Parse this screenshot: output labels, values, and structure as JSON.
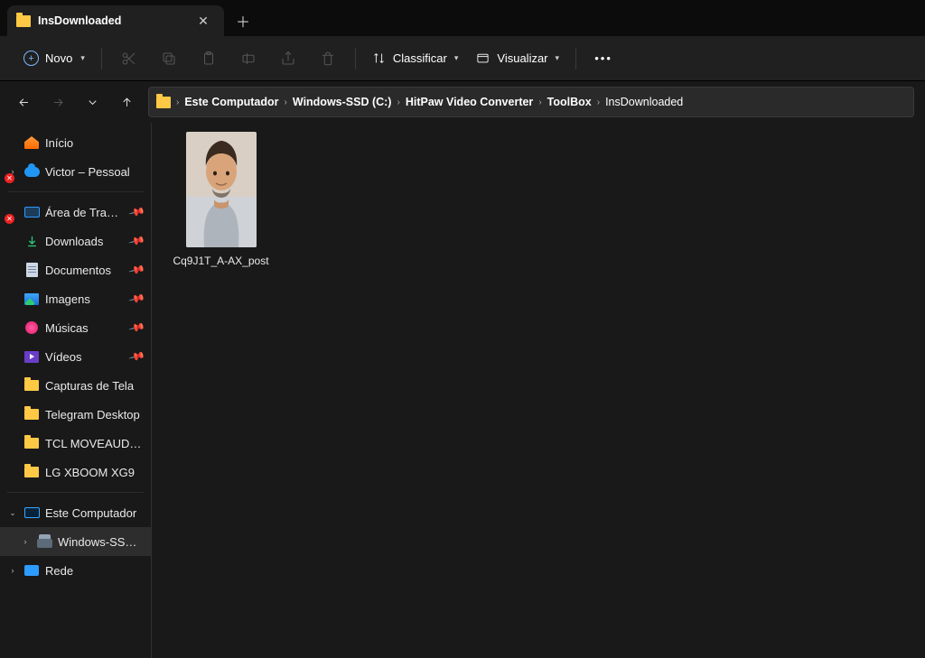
{
  "tab": {
    "title": "InsDownloaded"
  },
  "toolbar": {
    "novo": "Novo",
    "classificar": "Classificar",
    "visualizar": "Visualizar"
  },
  "breadcrumb": [
    "Este Computador",
    "Windows-SSD (C:)",
    "HitPaw Video Converter",
    "ToolBox",
    "InsDownloaded"
  ],
  "sidebar": {
    "home": "Início",
    "onedrive": "Victor – Pessoal",
    "quick": {
      "desktop": "Área de Trabalho",
      "downloads": "Downloads",
      "documents": "Documentos",
      "pictures": "Imagens",
      "music": "Músicas",
      "videos": "Vídeos",
      "cap": "Capturas de Tela",
      "telegram": "Telegram Desktop",
      "tcl": "TCL MOVEAUDIO S",
      "lg": "LG XBOOM XG9"
    },
    "pc": "Este Computador",
    "drive": "Windows-SSD (C:)",
    "network": "Rede"
  },
  "files": [
    {
      "name": "Cq9J1T_A-AX_post"
    }
  ]
}
